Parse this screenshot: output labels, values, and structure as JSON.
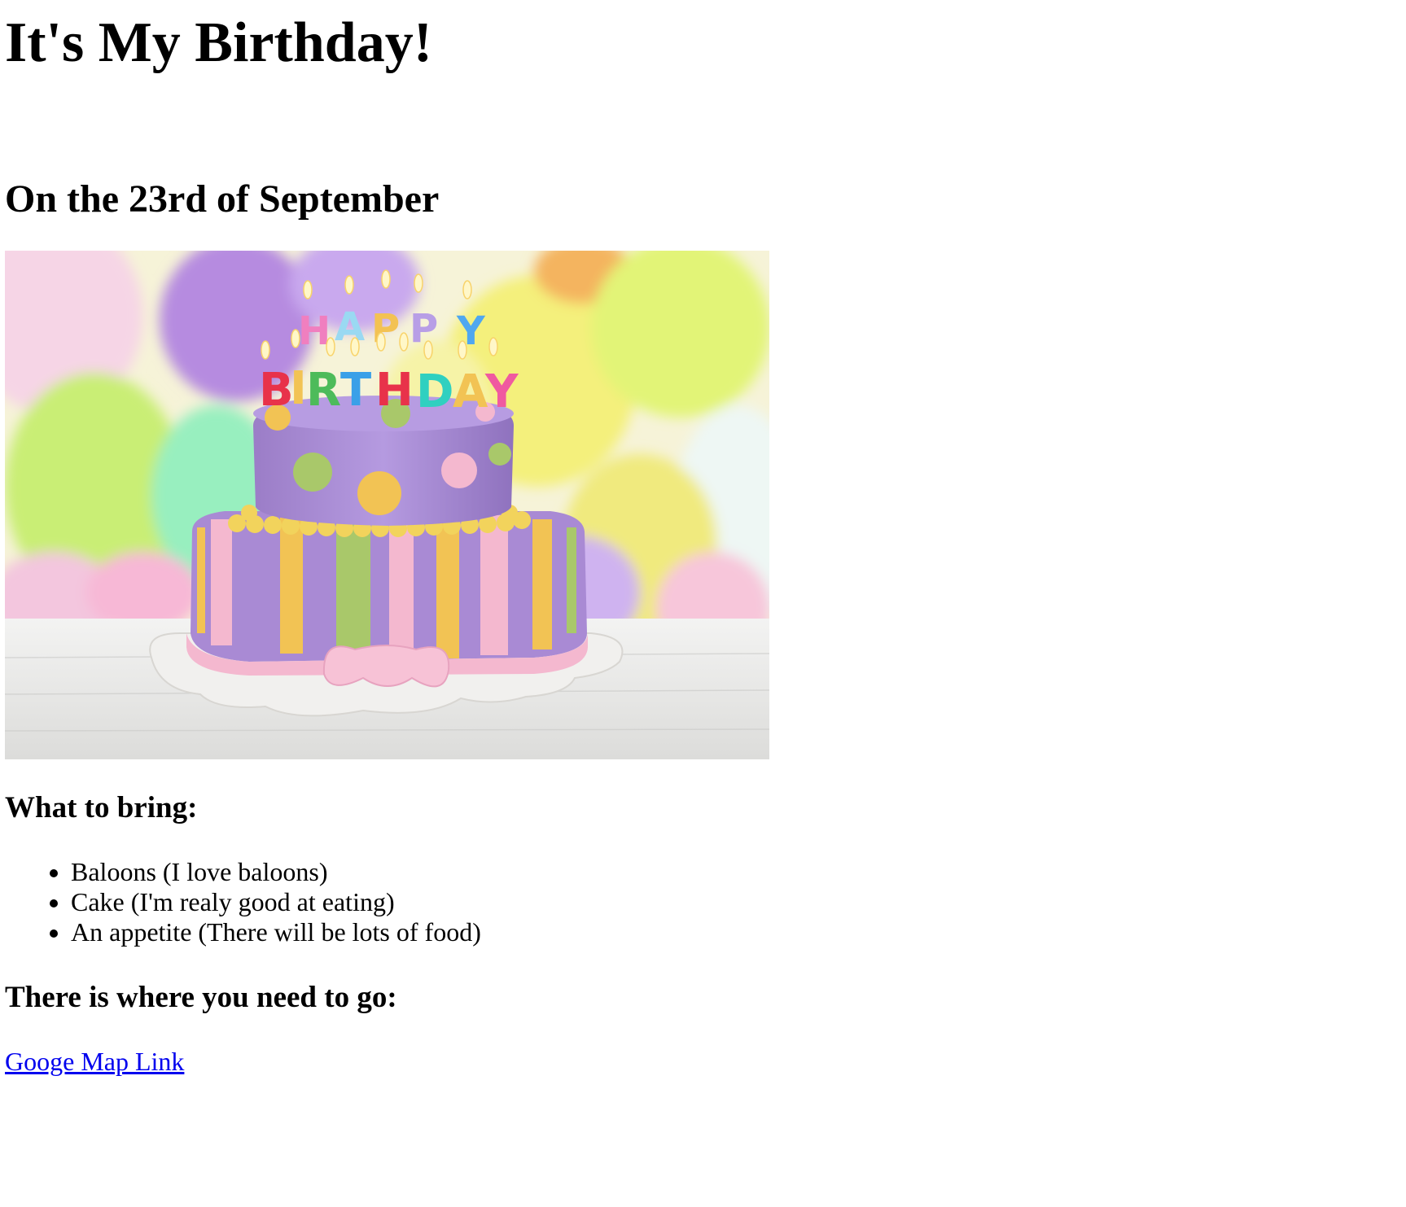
{
  "page": {
    "title": "It's My Birthday!",
    "date_heading": "On the 23rd of September"
  },
  "image": {
    "subject": "birthday-cake-photo",
    "candle_text": "HAPPY BIRTHDAY",
    "colors": {
      "background": "#f6f3d8",
      "cake_purple": "#a78bd1",
      "stripe_yellow": "#f2c354",
      "stripe_green": "#a9c86a",
      "stripe_pink": "#f4b8cf",
      "plate": "#f1f0ee"
    }
  },
  "bring": {
    "heading": "What to bring:",
    "items": [
      "Baloons (I love baloons)",
      "Cake (I'm realy good at eating)",
      "An appetite (There will be lots of food)"
    ]
  },
  "directions": {
    "heading": "There is where you need to go:",
    "link_label": "Googe Map Link",
    "link_color": "#0000ee"
  }
}
